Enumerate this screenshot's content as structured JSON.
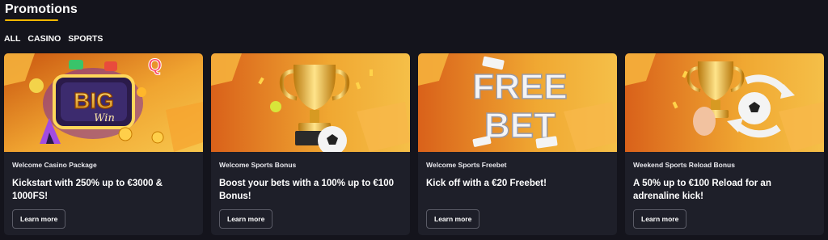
{
  "header": {
    "title": "Promotions"
  },
  "filters": [
    {
      "label": "ALL",
      "active": true
    },
    {
      "label": "CASINO",
      "active": false
    },
    {
      "label": "SPORTS",
      "active": false
    }
  ],
  "cards": [
    {
      "tag": "Welcome Casino Package",
      "title": "Kickstart with 250% up to €3000 & 1000FS!",
      "button": "Learn more",
      "image": {
        "graphic": "big-win-slot-sign",
        "sign_text_1": "BIG",
        "sign_text_2": "Win"
      }
    },
    {
      "tag": "Welcome Sports Bonus",
      "title": "Boost your bets with a 100% up to €100 Bonus!",
      "button": "Learn more",
      "image": {
        "graphic": "trophy-and-football"
      }
    },
    {
      "tag": "Welcome Sports Freebet",
      "title": "Kick off with a €20 Freebet!",
      "button": "Learn more",
      "image": {
        "graphic": "free-bet-text",
        "line_1": "FREE",
        "line_2": "BET"
      }
    },
    {
      "tag": "Weekend Sports Reload Bonus",
      "title": "A 50% up to €100 Reload for an adrenaline kick!",
      "button": "Learn more",
      "image": {
        "graphic": "trophy-with-reload-arrows"
      }
    }
  ],
  "colors": {
    "background": "#14141c",
    "card": "#1e1f29",
    "accent": "#f5b800",
    "banner_orange": "#e07a1c"
  }
}
